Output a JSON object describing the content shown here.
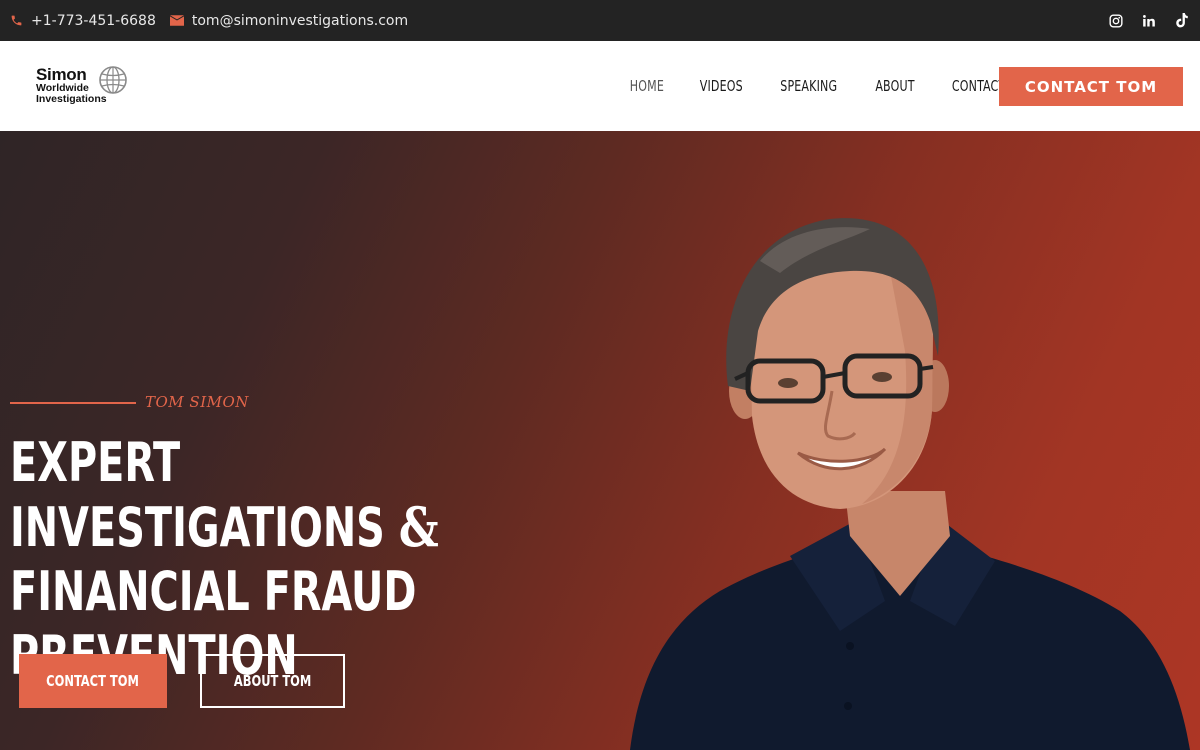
{
  "topbar": {
    "phone": "+1-773-451-6688",
    "email": "tom@simoninvestigations.com",
    "socials": [
      "instagram-icon",
      "linkedin-icon",
      "tiktok-icon"
    ]
  },
  "logo": {
    "line1": "Simon",
    "line2": "Worldwide",
    "line3": "Investigations"
  },
  "nav": {
    "items": [
      "HOME",
      "VIDEOS",
      "SPEAKING",
      "ABOUT",
      "CONTACT"
    ],
    "active": "HOME",
    "cta": "CONTACT TOM"
  },
  "hero": {
    "kicker": "TOM SIMON",
    "title_line1": "EXPERT INVESTIGATIONS",
    "title_amp": "&",
    "title_line2": "FINANCIAL FRAUD",
    "title_line3": "PREVENTION",
    "primary_button": "CONTACT TOM",
    "secondary_button": "ABOUT TOM"
  },
  "colors": {
    "accent": "#e2654a",
    "topbar_bg": "#232323",
    "hero_dark": "#2f2526",
    "hero_red": "#ad3625"
  }
}
